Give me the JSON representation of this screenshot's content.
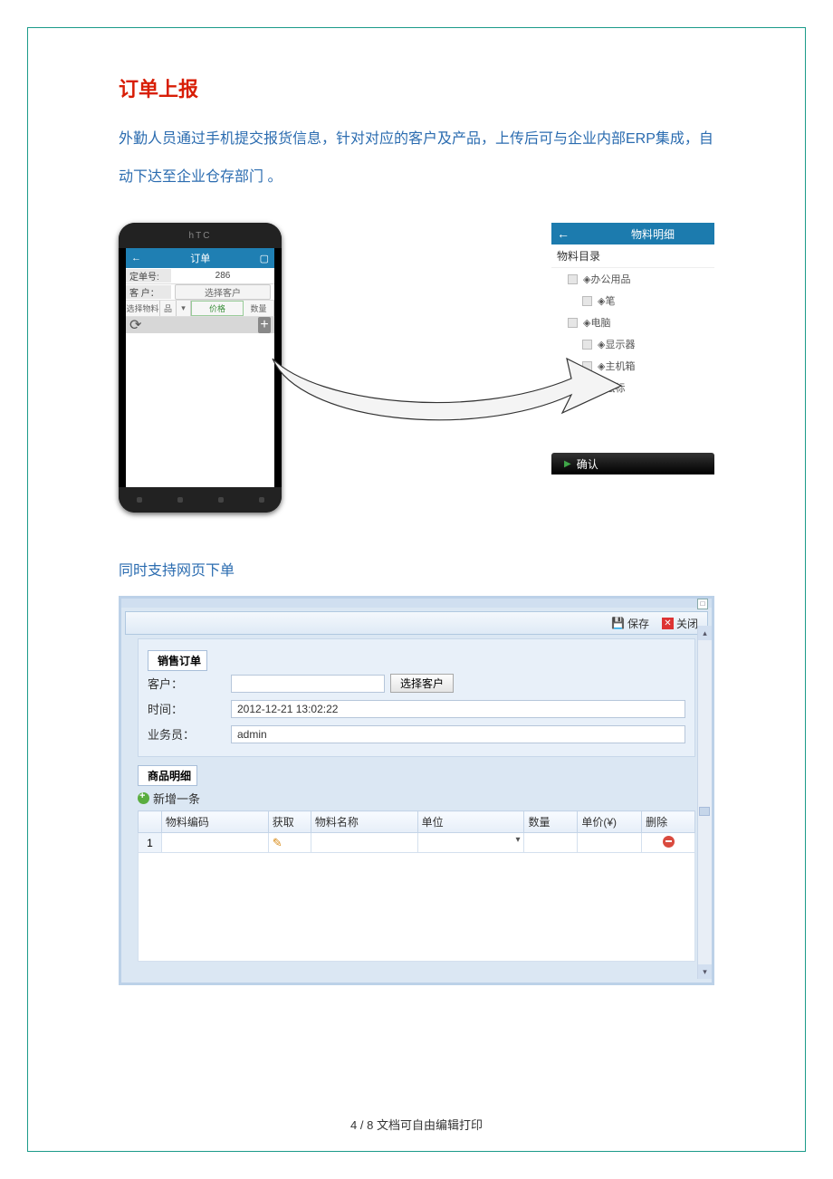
{
  "heading": "订单上报",
  "intro": "外勤人员通过手机提交报货信息，针对对应的客户及产品，上传后可与企业内部ERP集成，自动下达至企业仓存部门 。",
  "phone": {
    "brand": "hTC",
    "app_title": "订单",
    "order_no_label": "定单号:",
    "order_no": "286",
    "customer_label": "客 户：",
    "select_customer": "选择客户",
    "filters": {
      "select_material": "选择物料",
      "spec": "品",
      "price": "价格",
      "qty": "数量"
    }
  },
  "tree": {
    "title": "物料明细",
    "root": "物料目录",
    "cat1": "办公用品",
    "cat1_items": [
      "笔"
    ],
    "cat2": "电脑",
    "cat2_items": [
      "显示器",
      "主机箱",
      "鼠标"
    ],
    "confirm": "确认"
  },
  "subheading": "同时支持网页下单",
  "webform": {
    "save": "保存",
    "close": "关闭",
    "section1": "销售订单",
    "customer_label": "客户：",
    "select_customer_btn": "选择客户",
    "time_label": "时间：",
    "time_value": "2012-12-21 13:02:22",
    "staff_label": "业务员：",
    "staff_value": "admin",
    "section2": "商品明细",
    "add_row": "新增一条",
    "columns": {
      "code": "物料编码",
      "fetch": "获取",
      "name": "物料名称",
      "unit": "单位",
      "qty": "数量",
      "price": "单价(¥)",
      "delete": "删除"
    },
    "row1": "1"
  },
  "footer": "4 / 8 文档可自由编辑打印"
}
